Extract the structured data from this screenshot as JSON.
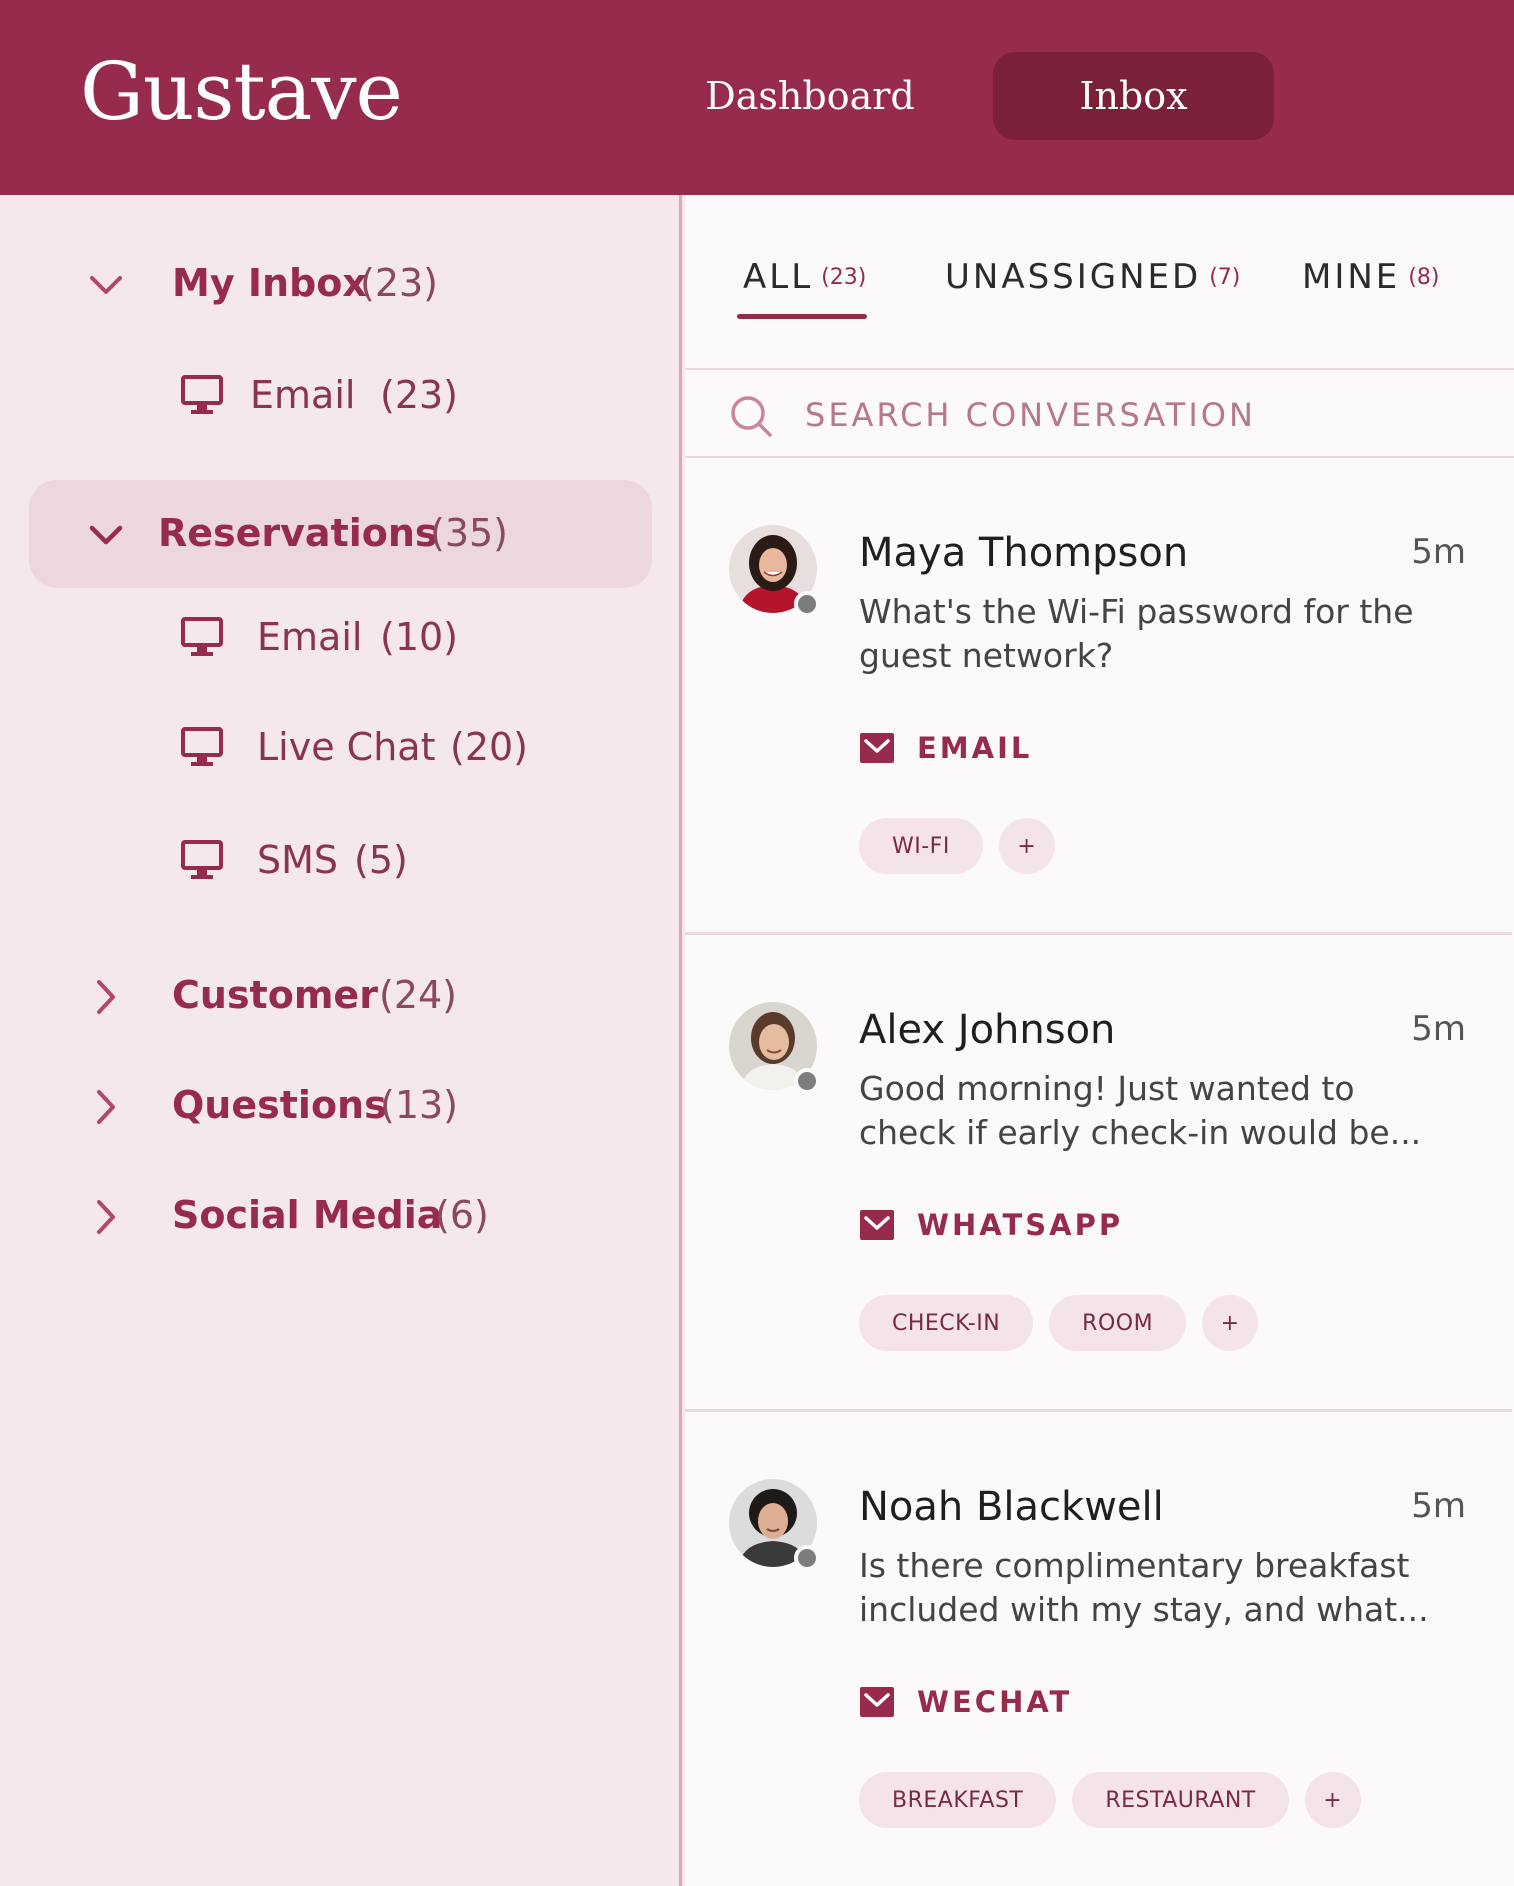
{
  "app": {
    "logo": "Gustave"
  },
  "nav": {
    "dashboard": "Dashboard",
    "inbox": "Inbox"
  },
  "sidebar": {
    "groups": [
      {
        "label": "My Inbox",
        "count": "(23)",
        "expanded": true,
        "items": [
          {
            "label": "Email",
            "count": "(23)",
            "icon": "monitor-icon"
          }
        ]
      },
      {
        "label": "Reservations",
        "count": "(35)",
        "expanded": true,
        "active": true,
        "items": [
          {
            "label": "Email",
            "count": "(10)",
            "icon": "monitor-icon"
          },
          {
            "label": "Live Chat",
            "count": "(20)",
            "icon": "monitor-icon"
          },
          {
            "label": "SMS",
            "count": "(5)",
            "icon": "monitor-icon"
          }
        ]
      },
      {
        "label": "Customer",
        "count": "(24)",
        "expanded": false
      },
      {
        "label": "Questions",
        "count": "(13)",
        "expanded": false
      },
      {
        "label": "Social Media",
        "count": "(6)",
        "expanded": false
      }
    ]
  },
  "tabs": [
    {
      "label": "ALL",
      "count": "(23)",
      "active": true
    },
    {
      "label": "UNASSIGNED",
      "count": "(7)"
    },
    {
      "label": "MINE",
      "count": "(8)"
    }
  ],
  "search": {
    "placeholder": "SEARCH CONVERSATION"
  },
  "conversations": [
    {
      "name": "Maya Thompson",
      "time": "5m",
      "preview": "What's the Wi-Fi password for the guest network?",
      "channel": "EMAIL",
      "tags": [
        "WI-FI"
      ],
      "add": "+"
    },
    {
      "name": "Alex Johnson",
      "time": "5m",
      "preview": "Good morning! Just wanted to check if early check-in would be...",
      "channel": "WHATSAPP",
      "tags": [
        "CHECK-IN",
        "ROOM"
      ],
      "add": "+"
    },
    {
      "name": "Noah Blackwell",
      "time": "5m",
      "preview": "Is there complimentary breakfast included with my stay, and what...",
      "channel": "WECHAT",
      "tags": [
        "BREAKFAST",
        "RESTAURANT"
      ],
      "add": "+"
    }
  ],
  "colors": {
    "brand": "#972b4c",
    "brand_dark": "#7a2039",
    "sidebar_bg": "#f4e8eb",
    "active_bg": "#ecd7dd",
    "status_offline": "#7d7d7d"
  }
}
